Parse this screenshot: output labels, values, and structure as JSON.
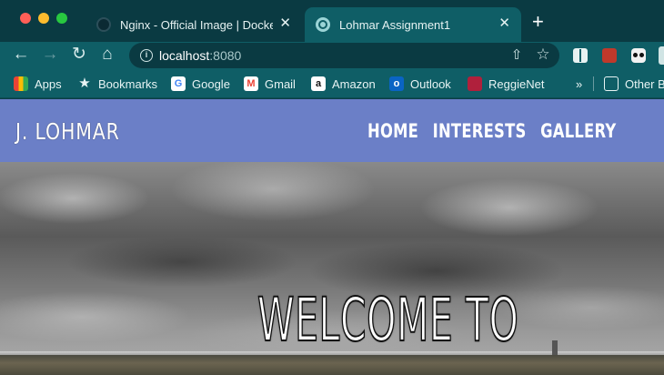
{
  "browser": {
    "tabs": [
      {
        "title": "Nginx - Official Image | Docker",
        "close": "✕"
      },
      {
        "title": "Lohmar Assignment1",
        "close": "✕"
      }
    ],
    "new_tab_label": "+",
    "url_host": "localhost",
    "url_port": ":8080",
    "info_glyph": "i",
    "bookmarks": {
      "apps": "Apps",
      "bookmarks": "Bookmarks",
      "google": "Google",
      "gmail": "Gmail",
      "amazon": "Amazon",
      "outlook": "Outlook",
      "reggienet": "ReggieNet",
      "overflow": "»",
      "other": "Other B"
    },
    "icons": {
      "back": "back-arrow-icon",
      "forward": "forward-arrow-icon",
      "reload": "reload-icon",
      "home": "home-icon",
      "share": "share-icon",
      "star": "star-icon"
    },
    "theme": {
      "frame": "#0a3a42",
      "toolbar": "#0f5e66"
    }
  },
  "site": {
    "brand": "J. LOHMAR",
    "nav": [
      "HOME",
      "INTERESTS",
      "GALLERY"
    ],
    "hero_title": "WELCOME TO",
    "header_color": "#6b7fc7"
  }
}
